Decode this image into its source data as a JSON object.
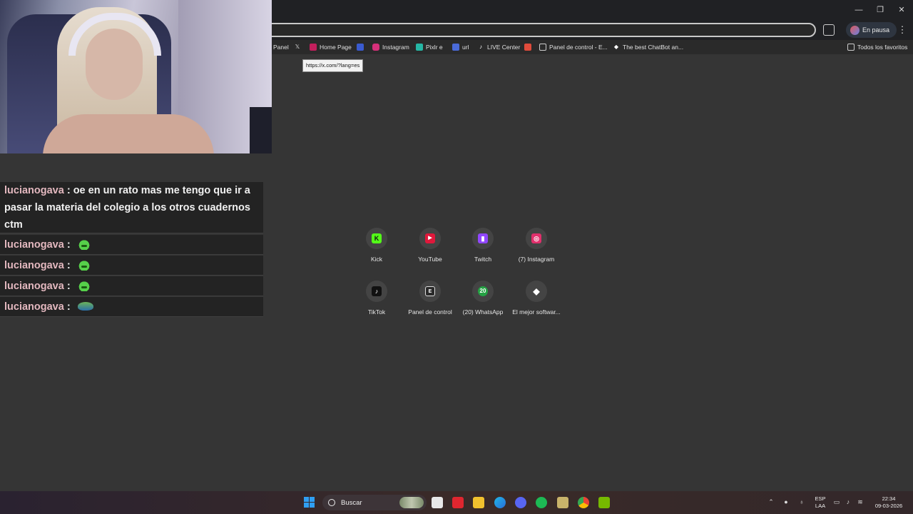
{
  "browser": {
    "pause_label": "En pausa",
    "tooltip": "https://x.com/?lang=es",
    "bookmarks": [
      {
        "label": "Panel",
        "icon": "panel-icon",
        "color": ""
      },
      {
        "label": "",
        "icon": "x-icon",
        "color": "#000000"
      },
      {
        "label": "Home Page",
        "icon": "home-page-icon",
        "color": "#c21f5c"
      },
      {
        "label": "",
        "icon": "blue-square-icon",
        "color": "#3a5bd0"
      },
      {
        "label": "Instagram",
        "icon": "instagram-icon",
        "color": "#d6307a"
      },
      {
        "label": "Pixlr e",
        "icon": "pixlr-icon",
        "color": "#25b7a5"
      },
      {
        "label": "url",
        "icon": "url-icon",
        "color": "#4a6ad8"
      },
      {
        "label": "LIVE Center",
        "icon": "tiktok-icon",
        "color": "#111111"
      },
      {
        "label": "",
        "icon": "gmail-icon",
        "color": "#e04b3b"
      },
      {
        "label": "Panel de control - E...",
        "icon": "page-icon",
        "color": "#cccccc"
      },
      {
        "label": "The best ChatBot an...",
        "icon": "diamond-icon",
        "color": "#ffffff"
      }
    ],
    "all_bookmarks": "Todos los favoritos"
  },
  "chat": {
    "messages": [
      {
        "user": "lucianogava",
        "text": "oe en un rato mas me tengo que ir a pasar la materia del colegio a los otros cuadernos ctm",
        "emote": ""
      },
      {
        "user": "lucianogava",
        "text": "",
        "emote": "frog-emote"
      },
      {
        "user": "lucianogava",
        "text": "",
        "emote": "frog-emote"
      },
      {
        "user": "lucianogava",
        "text": "",
        "emote": "frog-emote"
      },
      {
        "user": "lucianogava",
        "text": "",
        "emote": "pepe-emote"
      }
    ]
  },
  "shortcuts": [
    {
      "label": "Kick",
      "icon": "kick-icon",
      "color": "#53fc18",
      "glyph": "K"
    },
    {
      "label": "YouTube",
      "icon": "youtube-icon",
      "color": "#e0183b",
      "glyph": "▶"
    },
    {
      "label": "Twitch",
      "icon": "twitch-icon",
      "color": "#9146ff",
      "glyph": "▮"
    },
    {
      "label": "(7) Instagram",
      "icon": "instagram-icon",
      "color": "#e1306c",
      "glyph": "◎"
    },
    {
      "label": "TikTok",
      "icon": "tiktok-icon",
      "color": "#111111",
      "glyph": "♪"
    },
    {
      "label": "Panel de control",
      "icon": "epic-icon",
      "color": "#2a2a2a",
      "glyph": "E"
    },
    {
      "label": "(20) WhatsApp",
      "icon": "whatsapp-icon",
      "color": "#25a244",
      "glyph": "20"
    },
    {
      "label": "El mejor softwar...",
      "icon": "diamond-icon",
      "color": "#2a2a2a",
      "glyph": "◆"
    }
  ],
  "taskbar": {
    "search_placeholder": "Buscar",
    "lang_top": "ESP",
    "lang_bottom": "LAA",
    "time": "22:34",
    "date": "09-03-2026"
  },
  "colors": {
    "chat_user": "#e3b8bf",
    "page_bg": "#353535",
    "accent_blue": "#2f9ff3"
  }
}
